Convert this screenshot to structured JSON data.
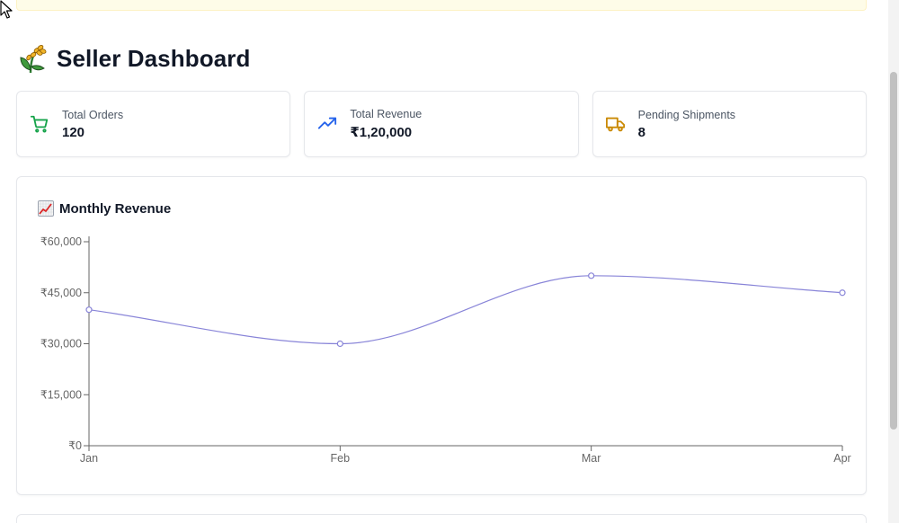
{
  "header": {
    "title": "Seller Dashboard",
    "logo_icon": "wheat-sprout-icon"
  },
  "stats": [
    {
      "label": "Total Orders",
      "value": "120",
      "icon": "cart-icon",
      "color": "#16a34a"
    },
    {
      "label": "Total Revenue",
      "value": "₹1,20,000",
      "icon": "trend-up-icon",
      "color": "#2563eb"
    },
    {
      "label": "Pending Shipments",
      "value": "8",
      "icon": "truck-icon",
      "color": "#ca8a04"
    }
  ],
  "chart_section": {
    "title": "Monthly Revenue",
    "icon": "chart-increasing-icon"
  },
  "chart_data": {
    "type": "line",
    "categories": [
      "Jan",
      "Feb",
      "Mar",
      "Apr"
    ],
    "series": [
      {
        "values": [
          40000,
          30000,
          50000,
          45000
        ],
        "color": "#8884d8"
      }
    ],
    "yticks": [
      0,
      15000,
      30000,
      45000,
      60000
    ],
    "ytick_labels": [
      "₹0",
      "₹15,000",
      "₹30,000",
      "₹45,000",
      "₹60,000"
    ],
    "ylim": [
      0,
      60000
    ],
    "grid": false,
    "curve": "smooth"
  }
}
